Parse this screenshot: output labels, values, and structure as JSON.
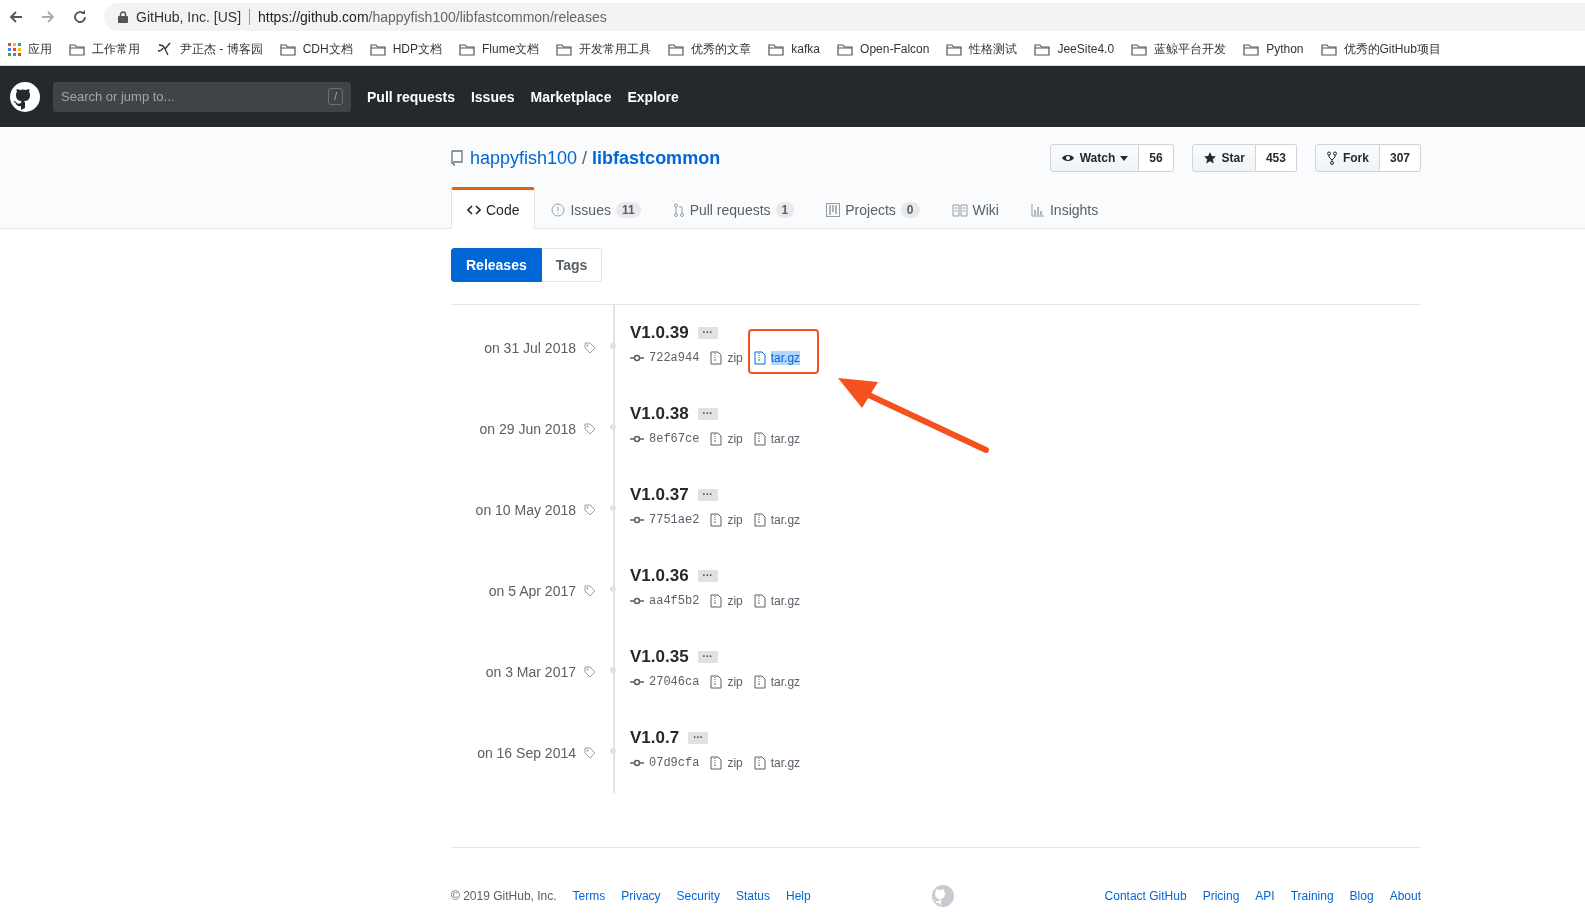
{
  "browser": {
    "site_identity": "GitHub, Inc. [US]",
    "url_host": "https://github.com",
    "url_path": "/happyfish100/libfastcommon/releases"
  },
  "bookmarks": [
    {
      "kind": "apps",
      "label": "应用"
    },
    {
      "kind": "folder",
      "label": "工作常用"
    },
    {
      "kind": "site",
      "label": "尹正杰 - 博客园"
    },
    {
      "kind": "folder",
      "label": "CDH文档"
    },
    {
      "kind": "folder",
      "label": "HDP文档"
    },
    {
      "kind": "folder",
      "label": "Flume文档"
    },
    {
      "kind": "folder",
      "label": "开发常用工具"
    },
    {
      "kind": "folder",
      "label": "优秀的文章"
    },
    {
      "kind": "folder",
      "label": "kafka"
    },
    {
      "kind": "folder",
      "label": "Open-Falcon"
    },
    {
      "kind": "folder",
      "label": "性格测试"
    },
    {
      "kind": "folder",
      "label": "JeeSite4.0"
    },
    {
      "kind": "folder",
      "label": "蓝鲸平台开发"
    },
    {
      "kind": "folder",
      "label": "Python"
    },
    {
      "kind": "folder",
      "label": "优秀的GitHub项目"
    }
  ],
  "header": {
    "search_placeholder": "Search or jump to...",
    "search_key": "/",
    "nav": [
      "Pull requests",
      "Issues",
      "Marketplace",
      "Explore"
    ]
  },
  "repo": {
    "owner": "happyfish100",
    "separator": "/",
    "name": "libfastcommon",
    "actions": [
      {
        "kind": "watch",
        "label": "Watch",
        "count": "56"
      },
      {
        "kind": "star",
        "label": "Star",
        "count": "453"
      },
      {
        "kind": "fork",
        "label": "Fork",
        "count": "307"
      }
    ],
    "tabs": [
      {
        "kind": "code",
        "label": "Code",
        "selected": true
      },
      {
        "kind": "issues",
        "label": "Issues",
        "count": "11",
        "selected": false
      },
      {
        "kind": "pulls",
        "label": "Pull requests",
        "count": "1",
        "selected": false
      },
      {
        "kind": "projects",
        "label": "Projects",
        "count": "0",
        "selected": false
      },
      {
        "kind": "wiki",
        "label": "Wiki",
        "selected": false
      },
      {
        "kind": "insights",
        "label": "Insights",
        "selected": false
      }
    ]
  },
  "subnav": [
    {
      "label": "Releases",
      "selected": true
    },
    {
      "label": "Tags",
      "selected": false
    }
  ],
  "releases": [
    {
      "date": "on 31 Jul 2018",
      "version": "V1.0.39",
      "more": "···",
      "commit": "722a944",
      "zip": "zip",
      "targz": "tar.gz",
      "targz_highlighted": true
    },
    {
      "date": "on 29 Jun 2018",
      "version": "V1.0.38",
      "more": "···",
      "commit": "8ef67ce",
      "zip": "zip",
      "targz": "tar.gz",
      "targz_highlighted": false
    },
    {
      "date": "on 10 May 2018",
      "version": "V1.0.37",
      "more": "···",
      "commit": "7751ae2",
      "zip": "zip",
      "targz": "tar.gz",
      "targz_highlighted": false
    },
    {
      "date": "on 5 Apr 2017",
      "version": "V1.0.36",
      "more": "···",
      "commit": "aa4f5b2",
      "zip": "zip",
      "targz": "tar.gz",
      "targz_highlighted": false
    },
    {
      "date": "on 3 Mar 2017",
      "version": "V1.0.35",
      "more": "···",
      "commit": "27046ca",
      "zip": "zip",
      "targz": "tar.gz",
      "targz_highlighted": false
    },
    {
      "date": "on 16 Sep 2014",
      "version": "V1.0.7",
      "more": "···",
      "commit": "07d9cfa",
      "zip": "zip",
      "targz": "tar.gz",
      "targz_highlighted": false
    }
  ],
  "footer": {
    "copyright": "© 2019 GitHub, Inc.",
    "left_links": [
      "Terms",
      "Privacy",
      "Security",
      "Status",
      "Help"
    ],
    "right_links": [
      "Contact GitHub",
      "Pricing",
      "API",
      "Training",
      "Blog",
      "About"
    ]
  }
}
